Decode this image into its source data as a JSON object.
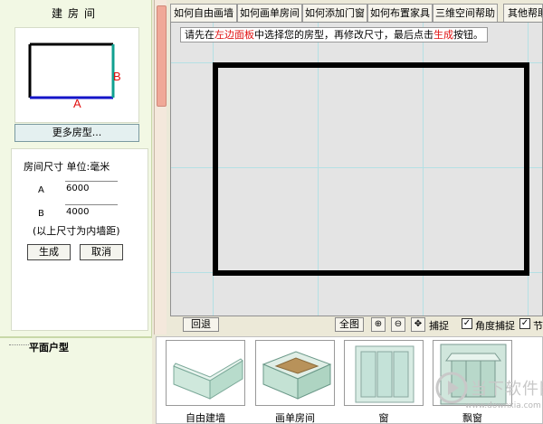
{
  "left_panel": {
    "title": "建房间",
    "preview_labels": {
      "width": "A",
      "height": "B"
    },
    "more_button": "更多房型...",
    "dimension_title": "房间尺寸 单位:毫米",
    "fields": [
      {
        "label": "A",
        "value": "6000"
      },
      {
        "label": "B",
        "value": "4000"
      }
    ],
    "note": "(以上尺寸为内墙距)",
    "generate_button": "生成",
    "cancel_button": "取消",
    "plan_title": "平面户型"
  },
  "tabs": [
    "如何自由画墙",
    "如何画单房间",
    "如何添加门窗",
    "如何布置家具",
    "三维空间帮助",
    "其他帮助"
  ],
  "canvas": {
    "instruction": {
      "prefix": "请先在",
      "highlight1": "左边面板",
      "middle": "中选择您的房型，再修改尺寸，最后点击",
      "highlight2": "生成",
      "suffix": "按钮。"
    }
  },
  "toolbar": {
    "undo_button": "回退",
    "fit_button": "全图",
    "zoom_in_icon": "zoom-in-icon",
    "zoom_out_icon": "zoom-out-icon",
    "checkboxes": [
      {
        "label": "捕捉",
        "checked": true
      },
      {
        "label": "角度捕捉",
        "checked": true
      },
      {
        "label": "节点",
        "checked": true
      }
    ]
  },
  "components": [
    {
      "label": "自由建墙",
      "icon": "free-wall-icon"
    },
    {
      "label": "画单房间",
      "icon": "single-room-icon"
    },
    {
      "label": "窗",
      "icon": "window-icon"
    },
    {
      "label": "飘窗",
      "icon": "bay-window-icon"
    }
  ],
  "watermark": {
    "title": "当下软件园",
    "url": "www.downxia.com"
  },
  "colors": {
    "wall": "#000000",
    "grid": "#b4e0e4",
    "highlight": "#e01010",
    "dimension_a": "#1414c8",
    "dimension_b": "#10a090"
  }
}
